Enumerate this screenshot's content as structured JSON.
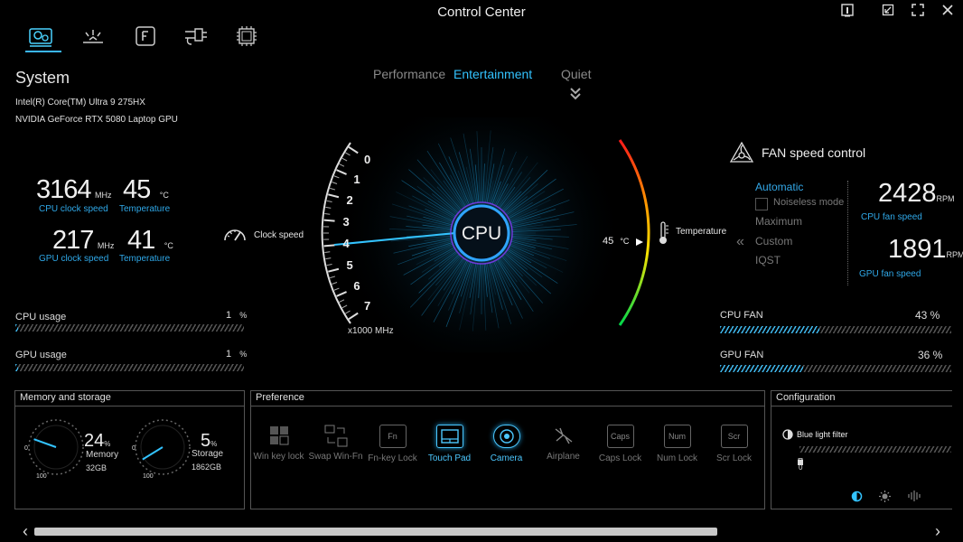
{
  "window": {
    "title": "Control Center"
  },
  "top_tabs": [
    {
      "name": "system-settings"
    },
    {
      "name": "lighting"
    },
    {
      "name": "fn-keys"
    },
    {
      "name": "devices"
    },
    {
      "name": "cpu"
    }
  ],
  "modes": {
    "performance": "Performance",
    "entertainment": "Entertainment",
    "quiet": "Quiet",
    "active": "Entertainment"
  },
  "system": {
    "title": "System",
    "cpu_name": "Intel(R) Core(TM) Ultra 9 275HX",
    "gpu_name": "NVIDIA GeForce RTX 5080 Laptop GPU",
    "cpu_clock": "3164",
    "cpu_clock_unit": "MHz",
    "cpu_clock_label": "CPU clock speed",
    "cpu_temp": "45",
    "cpu_temp_unit": "°C",
    "cpu_temp_label": "Temperature",
    "gpu_clock": "217",
    "gpu_clock_unit": "MHz",
    "gpu_clock_label": "GPU clock speed",
    "gpu_temp": "41",
    "gpu_temp_unit": "°C",
    "gpu_temp_label": "Temperature"
  },
  "usage": {
    "cpu_label": "CPU usage",
    "cpu_value": "1",
    "cpu_unit": "%",
    "cpu_fraction": 0.01,
    "gpu_label": "GPU usage",
    "gpu_value": "1",
    "gpu_unit": "%",
    "gpu_fraction": 0.01
  },
  "gauge": {
    "center_label": "CPU",
    "clock_label": "Clock speed",
    "scale_label": "x1000 MHz",
    "ticks": [
      "0",
      "1",
      "2",
      "3",
      "4",
      "5",
      "6",
      "7"
    ],
    "temp_readout": "45",
    "temp_unit": "°C",
    "temp_label": "Temperature"
  },
  "fan": {
    "title": "FAN speed control",
    "options": [
      "Automatic",
      "Noiseless mode",
      "Maximum",
      "Custom",
      "IQST"
    ],
    "selected": "Automatic",
    "cpu_rpm": "2428",
    "rpm_unit": "RPM",
    "cpu_rpm_label": "CPU fan speed",
    "gpu_rpm": "1891",
    "gpu_rpm_label": "GPU fan speed",
    "cpu_fan_label": "CPU FAN",
    "cpu_fan_value": "43 %",
    "cpu_fan_fraction": 0.43,
    "gpu_fan_label": "GPU FAN",
    "gpu_fan_value": "36 %",
    "gpu_fan_fraction": 0.36
  },
  "memory": {
    "title": "Memory and storage",
    "mem_percent": "24",
    "mem_label": "Memory",
    "mem_size": "32GB",
    "mem_fraction": 0.24,
    "storage_percent": "5",
    "storage_label": "Storage",
    "storage_size": "1862GB",
    "storage_fraction": 0.05,
    "percent_unit": "%",
    "dial_min": "0",
    "dial_max": "100"
  },
  "preference": {
    "title": "Preference",
    "items": [
      {
        "label": "Win key lock",
        "icon": "win-key-lock-icon",
        "on": false
      },
      {
        "label": "Swap Win-Fn",
        "icon": "swap-win-fn-icon",
        "on": false
      },
      {
        "label": "Fn-key Lock",
        "icon": "fn-key-lock-icon",
        "glyph": "Fn",
        "on": false
      },
      {
        "label": "Touch Pad",
        "icon": "touchpad-icon",
        "on": true
      },
      {
        "label": "Camera",
        "icon": "camera-icon",
        "on": true
      },
      {
        "label": "Airplane",
        "icon": "airplane-icon",
        "on": false
      },
      {
        "label": "Caps Lock",
        "icon": "caps-lock-icon",
        "glyph": "Caps",
        "on": false
      },
      {
        "label": "Num Lock",
        "icon": "num-lock-icon",
        "glyph": "Num",
        "on": false
      },
      {
        "label": "Scr Lock",
        "icon": "scroll-lock-icon",
        "glyph": "Scr",
        "on": false
      }
    ]
  },
  "configuration": {
    "title": "Configuration",
    "blue_light_label": "Blue light filter",
    "blue_light_value": "0"
  },
  "colors": {
    "accent": "#33c3ff",
    "background": "#000000"
  }
}
